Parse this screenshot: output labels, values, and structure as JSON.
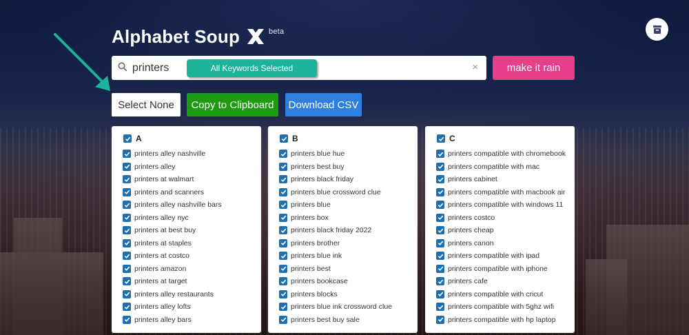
{
  "app": {
    "title": "Alphabet Soup",
    "beta": "beta"
  },
  "search": {
    "query": "printers",
    "placeholder": "",
    "pill": "All Keywords Selected",
    "clear": "×"
  },
  "buttons": {
    "make_it_rain": "make it rain",
    "select_none": "Select None",
    "copy": "Copy to Clipboard",
    "csv": "Download CSV"
  },
  "colors": {
    "pill": "#1cb39b",
    "rain": "#e73e8a",
    "copy": "#1f9b12",
    "csv": "#2f7fe0",
    "checkbox": "#1e6fb0",
    "arrow": "#1cb39b"
  },
  "columns": [
    {
      "letter": "A",
      "items": [
        "printers alley nashville",
        "printers alley",
        "printers at walmart",
        "printers and scanners",
        "printers alley nashville bars",
        "printers alley nyc",
        "printers at best buy",
        "printers at staples",
        "printers at costco",
        "printers amazon",
        "printers at target",
        "printers alley restaurants",
        "printers alley lofts",
        "printers alley bars"
      ]
    },
    {
      "letter": "B",
      "items": [
        "printers blue hue",
        "printers best buy",
        "printers black friday",
        "printers blue crossword clue",
        "printers blue",
        "printers box",
        "printers black friday 2022",
        "printers brother",
        "printers blue ink",
        "printers best",
        "printers bookcase",
        "printers blocks",
        "printers blue ink crossword clue",
        "printers best buy sale"
      ]
    },
    {
      "letter": "C",
      "items": [
        "printers compatible with chromebook",
        "printers compatible with mac",
        "printers cabinet",
        "printers compatible with macbook air",
        "printers compatible with windows 11",
        "printers costco",
        "printers cheap",
        "printers canon",
        "printers compatible with ipad",
        "printers compatible with iphone",
        "printers cafe",
        "printers compatible with cricut",
        "printers compatible with 5ghz wifi",
        "printers compatible with hp laptop"
      ]
    }
  ]
}
